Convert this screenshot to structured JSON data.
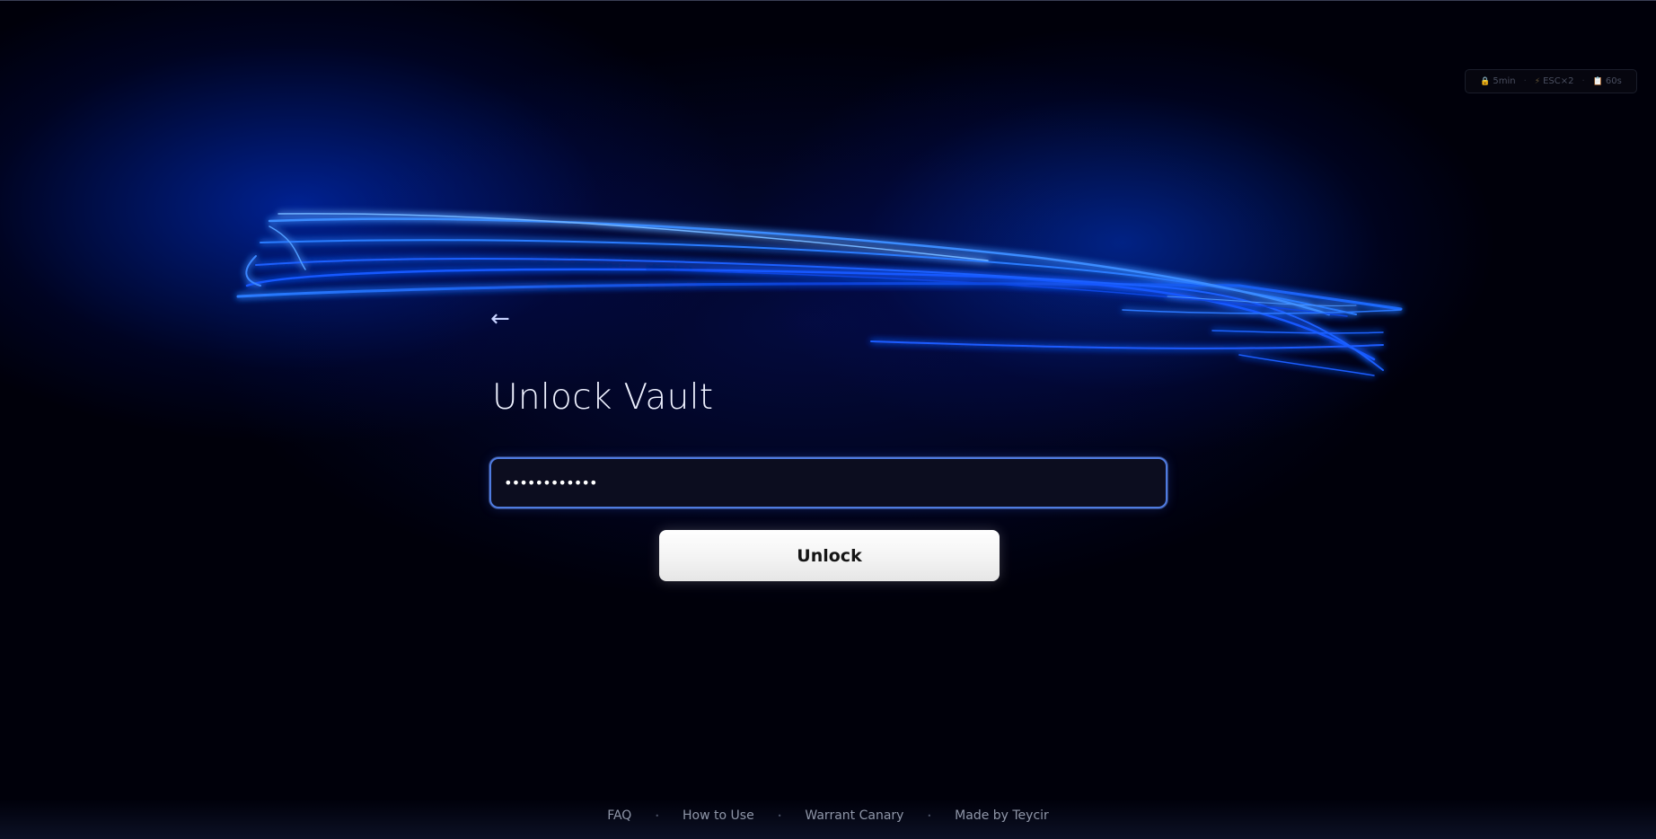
{
  "status": {
    "items": [
      {
        "icon": "lock-icon",
        "glyph": "🔒",
        "text": "5min"
      },
      {
        "icon": "lightning-icon",
        "glyph": "⚡",
        "text": "ESC×2"
      },
      {
        "icon": "clipboard-icon",
        "glyph": "📋",
        "text": "60s"
      }
    ]
  },
  "nav": {
    "back_glyph": "←"
  },
  "main": {
    "title": "Unlock Vault",
    "password_value": "••••••••••••",
    "unlock_label": "Unlock"
  },
  "footer": {
    "links": [
      "FAQ",
      "How to Use",
      "Warrant Canary",
      "Made by Teycir"
    ],
    "separator": "•"
  },
  "colors": {
    "accent": "#4f7be0",
    "background": "#00000a",
    "glow": "#1a5cff"
  }
}
